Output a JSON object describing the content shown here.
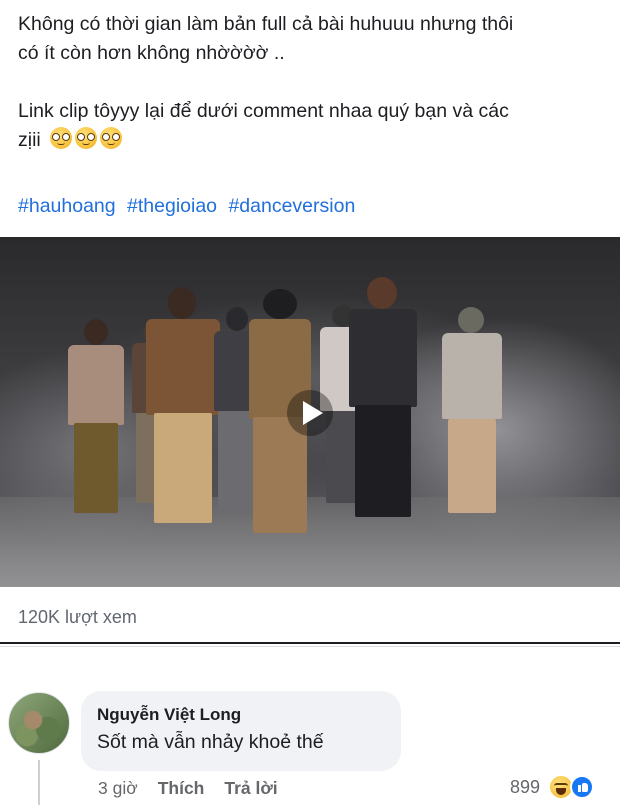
{
  "post": {
    "line1": "Không có thời gian làm bản full cả bài huhuuu nhưng thôi",
    "line2": "có ít còn hơn không nhờờờờ ..",
    "line3": "Link clip tôyyy lại để dưới comment nhaa quý bạn và các",
    "line4": "zịii",
    "emoji_icons": [
      "nerd-face-emoji",
      "nerd-face-emoji",
      "nerd-face-emoji"
    ],
    "hashtags": [
      "#hauhoang",
      "#thegioiao",
      "#danceversion"
    ]
  },
  "video": {
    "views_label": "120K lượt xem"
  },
  "comment": {
    "author": "Nguyễn Việt Long",
    "text": "Sốt mà vẫn nhảy khoẻ thế",
    "time": "3 giờ",
    "like_label": "Thích",
    "reply_label": "Trả lời",
    "reaction_count": "899",
    "reaction_icons": [
      "haha-icon",
      "like-icon"
    ]
  },
  "colors": {
    "hashtag": "#216fdb",
    "secondary_text": "#65676b",
    "bubble_bg": "#f0f2f5",
    "like_blue": "#1877f2"
  }
}
